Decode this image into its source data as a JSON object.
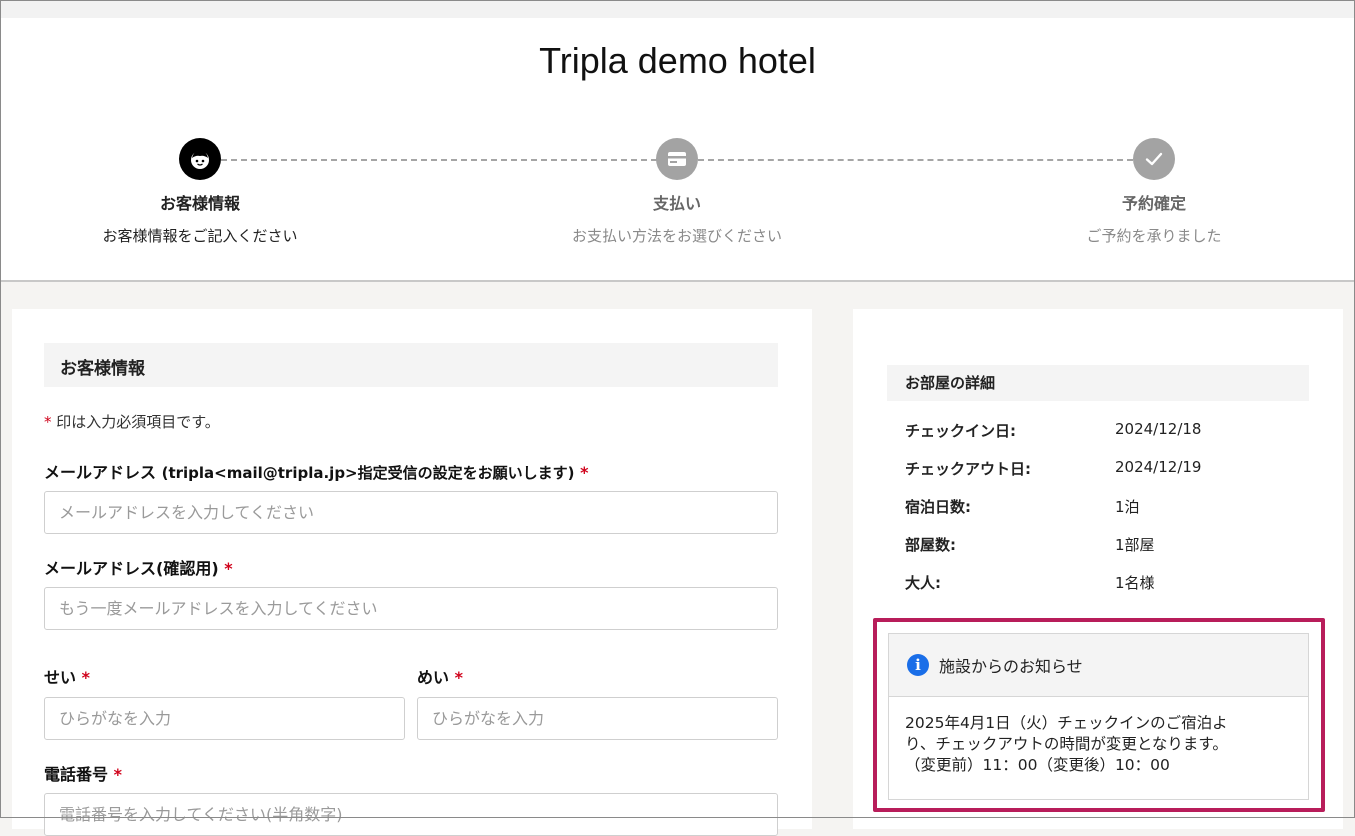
{
  "header": {
    "hotel_name": "Tripla demo hotel"
  },
  "steps": [
    {
      "title": "お客様情報",
      "subtitle": "お客様情報をご記入ください",
      "icon": "face-icon",
      "state": "active"
    },
    {
      "title": "支払い",
      "subtitle": "お支払い方法をお選びください",
      "icon": "card-icon",
      "state": "inactive"
    },
    {
      "title": "予約確定",
      "subtitle": "ご予約を承りました",
      "icon": "check-icon",
      "state": "inactive"
    }
  ],
  "form": {
    "section_title": "お客様情報",
    "required_marker": "*",
    "required_note": "印は入力必須項目です。",
    "email": {
      "label": "メールアドレス",
      "label_note": "(tripla<mail@tripla.jp>指定受信の設定をお願いします)",
      "placeholder": "メールアドレスを入力してください",
      "value": ""
    },
    "email_confirm": {
      "label": "メールアドレス(確認用)",
      "placeholder": "もう一度メールアドレスを入力してください",
      "value": ""
    },
    "last_name_kana": {
      "label": "せい",
      "placeholder": "ひらがなを入力",
      "value": ""
    },
    "first_name_kana": {
      "label": "めい",
      "placeholder": "ひらがなを入力",
      "value": ""
    },
    "phone": {
      "label": "電話番号",
      "placeholder": "電話番号を入力してください(半角数字)",
      "value": ""
    }
  },
  "room": {
    "section_title": "お部屋の詳細",
    "details": [
      {
        "label": "チェックイン日:",
        "value": "2024/12/18"
      },
      {
        "label": "チェックアウト日:",
        "value": "2024/12/19"
      },
      {
        "label": "宿泊日数:",
        "value": "1泊"
      },
      {
        "label": "部屋数:",
        "value": "1部屋"
      },
      {
        "label": "大人:",
        "value": "1名様"
      }
    ]
  },
  "notice": {
    "title": "施設からのお知らせ",
    "lines": [
      "2025年4月1日（火）チェックインのご宿泊よ",
      "り、チェックアウトの時間が変更となります。",
      "（変更前）11：00（変更後）10：00"
    ]
  },
  "colors": {
    "accent_required": "#d0021b",
    "notice_highlight": "#b81d5a",
    "info_icon": "#1a6ee8",
    "step_active": "#000000",
    "step_inactive": "#a3a3a3"
  }
}
